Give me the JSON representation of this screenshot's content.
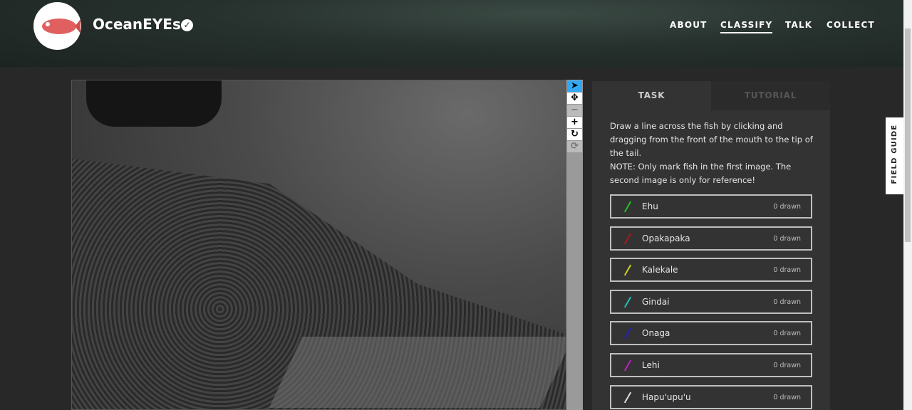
{
  "header": {
    "title": "OceanEYEs",
    "nav": [
      "ABOUT",
      "CLASSIFY",
      "TALK",
      "COLLECT"
    ]
  },
  "tabs": {
    "task": "TASK",
    "tutorial": "TUTORIAL"
  },
  "instructions": "Draw a line across the fish by clicking and dragging from the front of the mouth to the tip of the tail.",
  "note": "NOTE: Only mark fish in the first image. The second image is only for reference!",
  "tools": [
    "pointer",
    "move",
    "zoom-out",
    "zoom-in",
    "rotate",
    "reset"
  ],
  "species": [
    {
      "name": "Ehu",
      "count": "0 drawn",
      "color": "#22c022"
    },
    {
      "name": "Opakapaka",
      "count": "0 drawn",
      "color": "#b01818"
    },
    {
      "name": "Kalekale",
      "count": "0 drawn",
      "color": "#d0d020"
    },
    {
      "name": "Gindai",
      "count": "0 drawn",
      "color": "#20c0b0"
    },
    {
      "name": "Onaga",
      "count": "0 drawn",
      "color": "#2020c0"
    },
    {
      "name": "Lehi",
      "count": "0 drawn",
      "color": "#c020c0"
    },
    {
      "name": "Hapu'upu'u",
      "count": "0 drawn",
      "color": "#dddddd"
    }
  ],
  "field_guide": "FIELD GUIDE"
}
